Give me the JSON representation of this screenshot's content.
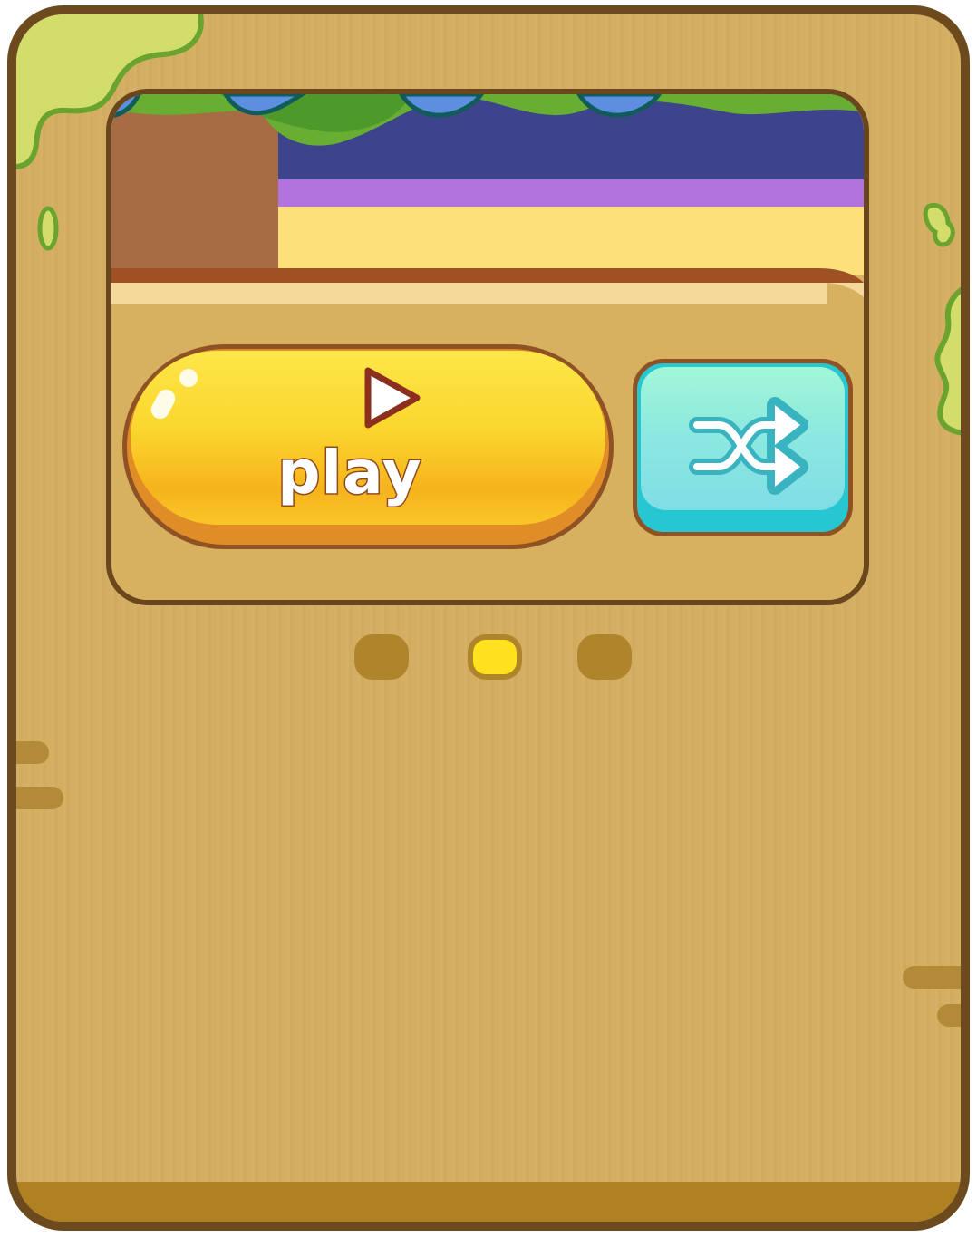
{
  "card": {
    "play_button": {
      "label": "play",
      "icon": "play-triangle-icon",
      "colors": {
        "face": "#fbd62e",
        "outline": "#8f5225"
      }
    },
    "shuffle_button": {
      "icon": "shuffle-icon",
      "colors": {
        "face": "#8de9df",
        "outline": "#8f5225"
      }
    }
  },
  "pager": {
    "page_count": 3,
    "active_index": 1,
    "colors": {
      "inactive": "#b0842a",
      "active": "#ffe21d"
    }
  },
  "theme": {
    "board_wood": "#d4ae62",
    "board_border": "#6c4a1e",
    "moss": "#d2dd6c"
  }
}
